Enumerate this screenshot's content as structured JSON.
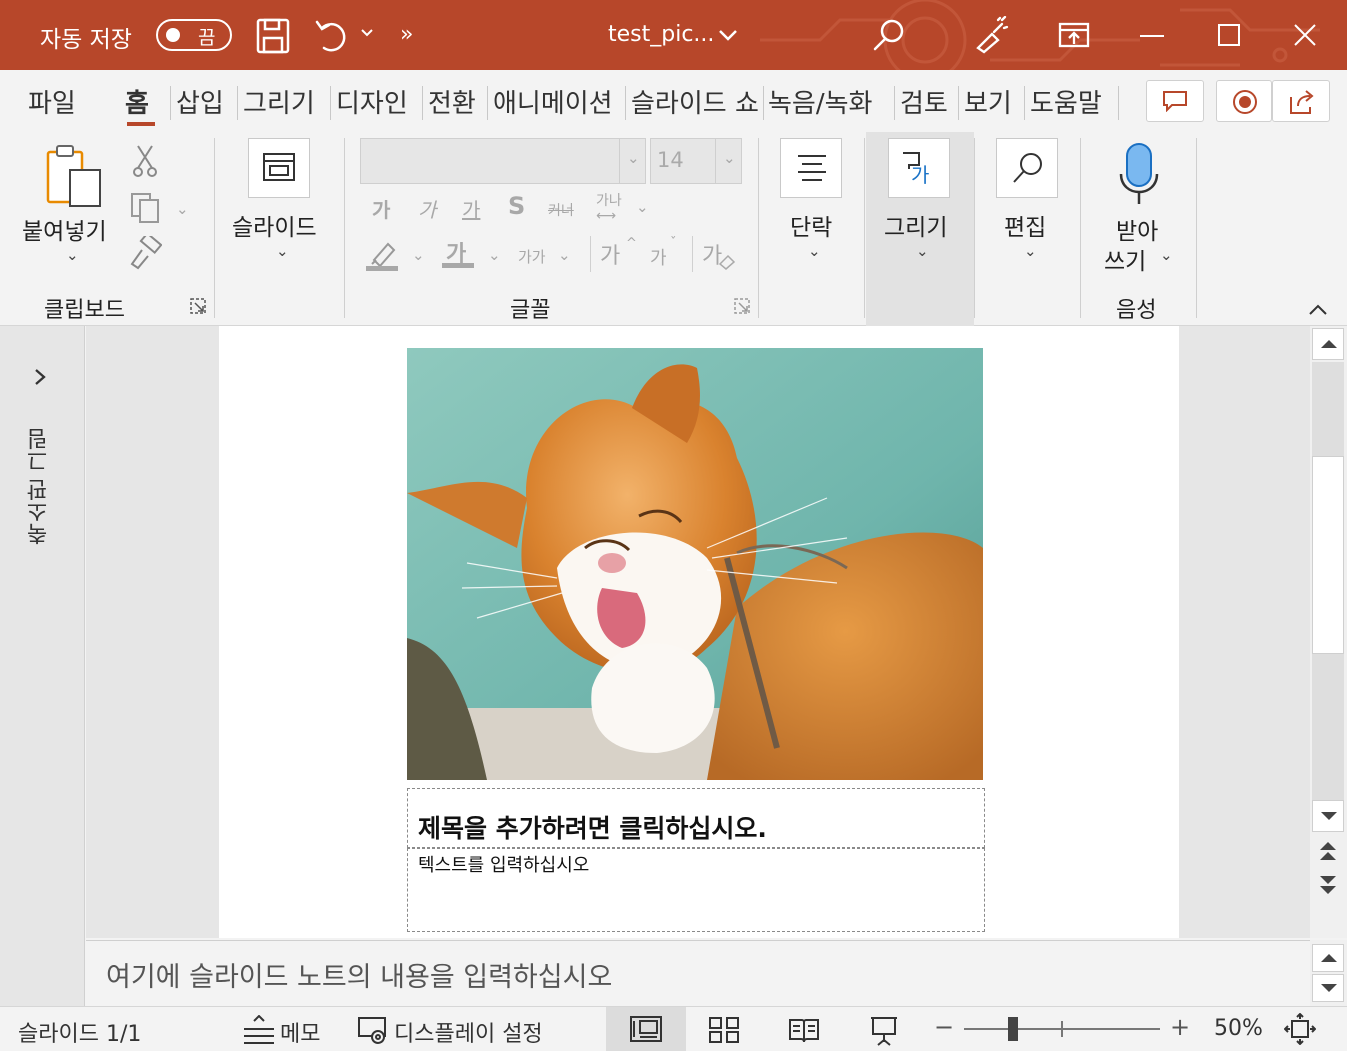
{
  "titlebar": {
    "autosave_label": "자동 저장",
    "autosave_state": "끔",
    "file_title": "test_pic...",
    "overflow_label": "»",
    "background_color": "#b7472a"
  },
  "tabs": {
    "items": [
      "파일",
      "홈",
      "삽입",
      "그리기",
      "디자인",
      "전환",
      "애니메이션",
      "슬라이드 쇼",
      "녹음/녹화",
      "검토",
      "보기",
      "도움말"
    ],
    "active": "홈"
  },
  "ribbon": {
    "clipboard": {
      "paste_label": "붙여넣기",
      "group_label": "클립보드"
    },
    "slides": {
      "slide_label": "슬라이드"
    },
    "font": {
      "font_name": "",
      "font_size": "14",
      "bold": "가",
      "italic": "가",
      "underline": "가",
      "shadow": "S",
      "strikethrough": "커너",
      "spacing": "가나",
      "case": "가가",
      "grow": "가",
      "shrink": "가",
      "clear": "가",
      "font_color": "가",
      "group_label": "글꼴"
    },
    "paragraph": {
      "label": "단락"
    },
    "drawing": {
      "label": "그리기",
      "icon_text": "가"
    },
    "editing": {
      "label": "편집"
    },
    "voice": {
      "dictate_line1": "받아",
      "dictate_line2": "쓰기",
      "group_label": "음성"
    }
  },
  "left_pane": {
    "label": "축소판 그림"
  },
  "slide": {
    "title_placeholder": "제목을 추가하려면 클릭하십시오.",
    "body_placeholder": "텍스트를 입력하십시오"
  },
  "notes": {
    "placeholder": "여기에 슬라이드 노트의 내용을 입력하십시오"
  },
  "status": {
    "slide_counter": "슬라이드 1/1",
    "notes_label": "메모",
    "display_settings": "디스플레이 설정",
    "zoom_minus": "−",
    "zoom_plus": "+",
    "zoom_level": "50%",
    "zoom_fraction": 0.5
  }
}
